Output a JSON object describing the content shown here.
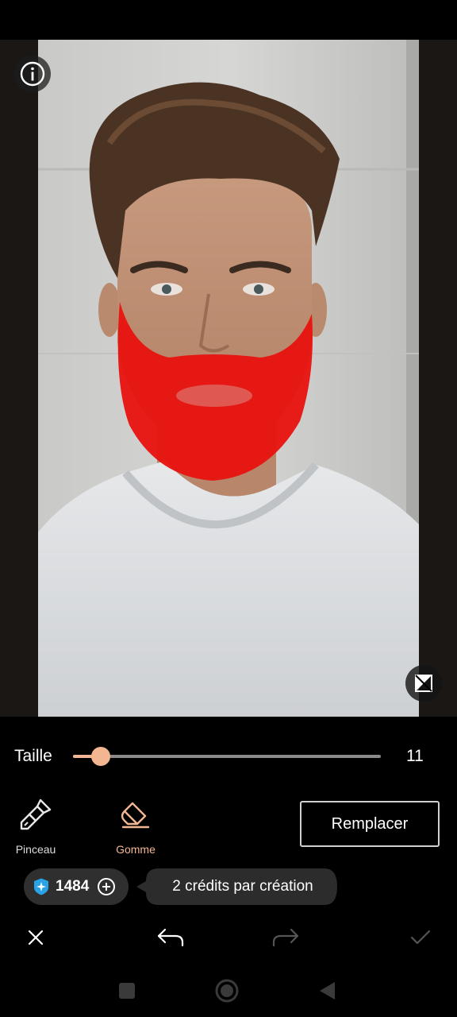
{
  "canvas": {
    "info_icon": "info-icon",
    "compare_icon": "compare-icon"
  },
  "size_control": {
    "label": "Taille",
    "value": "11",
    "level_fraction": 0.09,
    "accent_color": "#f4b690"
  },
  "tools": {
    "brush": {
      "label": "Pinceau",
      "icon": "brush-icon"
    },
    "eraser": {
      "label": "Gomme",
      "icon": "eraser-icon",
      "selected": true
    },
    "replace_label": "Remplacer"
  },
  "credits": {
    "count": "1484",
    "gem_icon": "gem-icon",
    "add_icon": "plus-circle-icon",
    "tooltip": "2 crédits par création"
  },
  "actions": {
    "cancel_icon": "close-icon",
    "undo_icon": "undo-icon",
    "redo_icon": "redo-icon",
    "confirm_icon": "check-icon"
  },
  "colors": {
    "mask": "#e81410",
    "background": "#000000",
    "accent": "#f4b690"
  }
}
